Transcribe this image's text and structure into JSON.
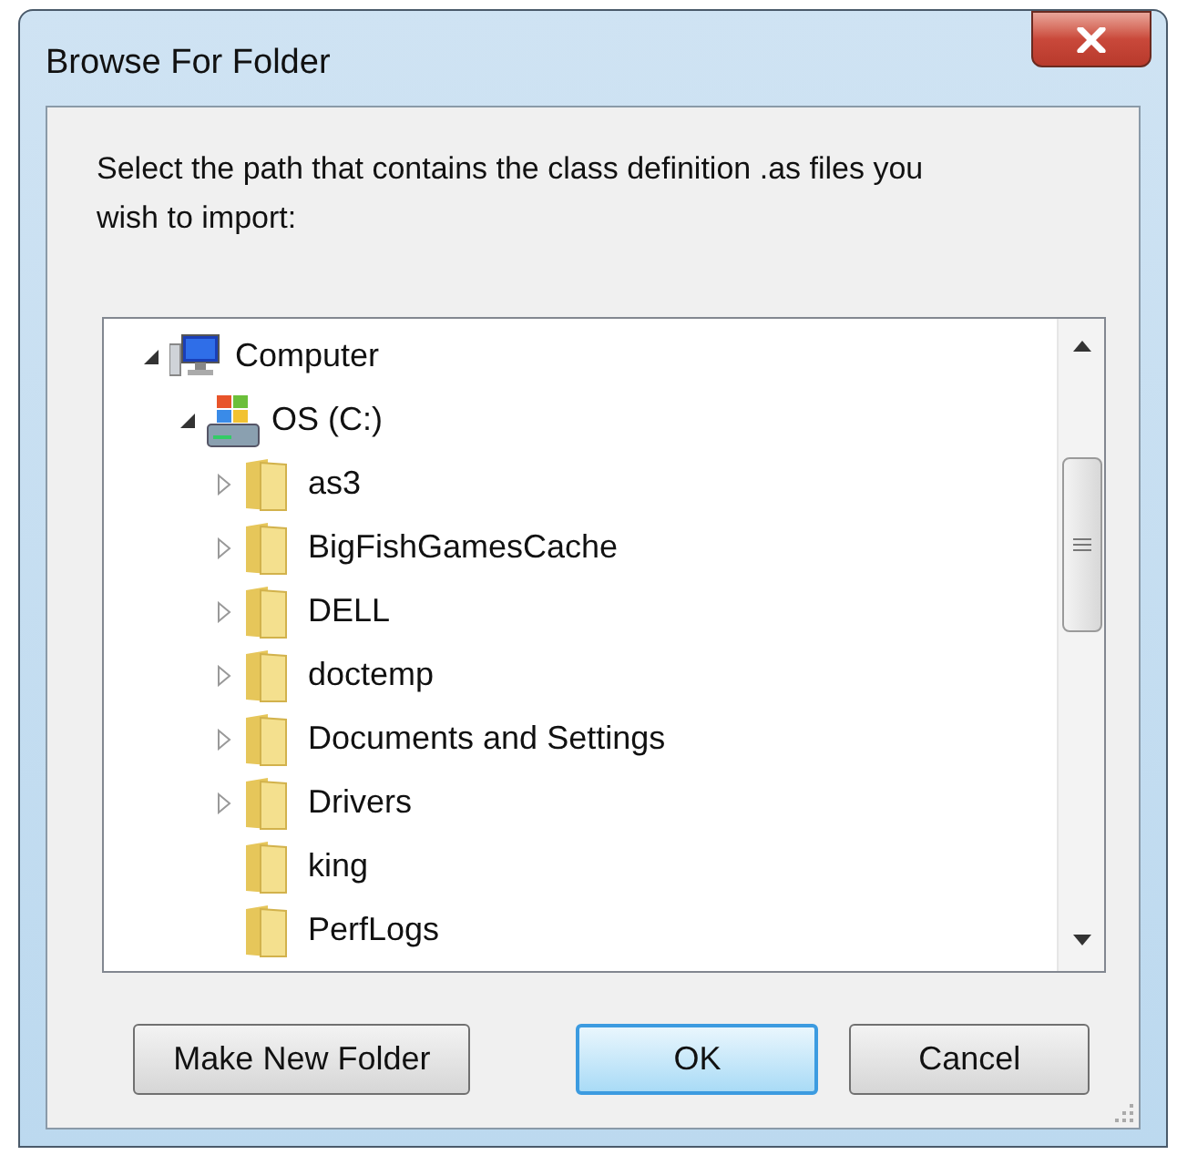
{
  "window": {
    "title": "Browse For Folder"
  },
  "instruction": "Select the path that contains the class definition .as files you wish to import:",
  "tree": [
    {
      "label": "Computer",
      "kind": "computer",
      "expanded": true,
      "children": [
        {
          "label": "OS (C:)",
          "kind": "drive",
          "expanded": true,
          "children": [
            {
              "label": "as3",
              "kind": "folder",
              "expanded": false
            },
            {
              "label": "BigFishGamesCache",
              "kind": "folder",
              "expanded": false
            },
            {
              "label": "DELL",
              "kind": "folder",
              "expanded": false
            },
            {
              "label": "doctemp",
              "kind": "folder",
              "expanded": false
            },
            {
              "label": "Documents and Settings",
              "kind": "folder",
              "expanded": false
            },
            {
              "label": "Drivers",
              "kind": "folder",
              "expanded": false
            },
            {
              "label": "king",
              "kind": "folder"
            },
            {
              "label": "PerfLogs",
              "kind": "folder"
            }
          ]
        }
      ]
    }
  ],
  "buttons": [
    {
      "label": "Make New Folder",
      "default": false
    },
    {
      "label": "OK",
      "default": true
    },
    {
      "label": "Cancel",
      "default": false
    }
  ]
}
